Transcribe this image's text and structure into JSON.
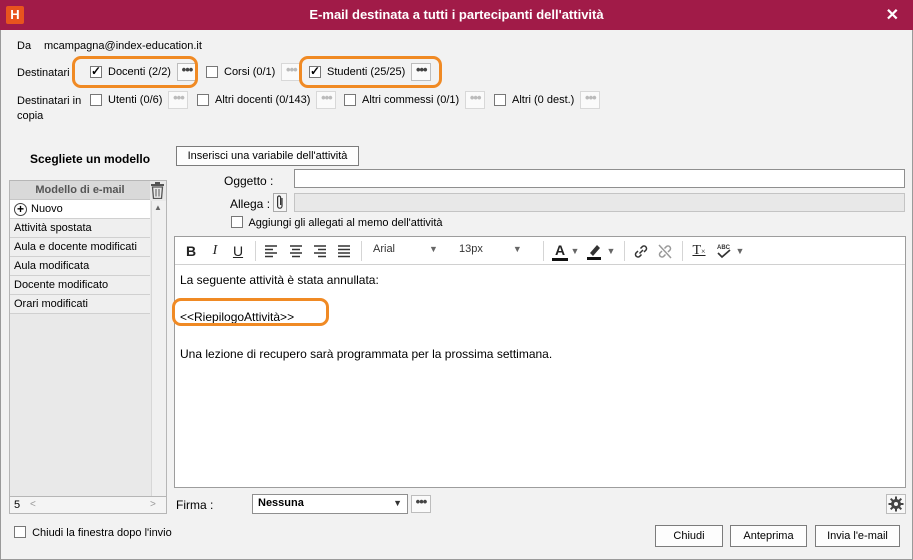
{
  "window": {
    "title": "E-mail destinata a tutti i partecipanti dell'attività",
    "app_icon": "H"
  },
  "from": {
    "label": "Da",
    "value": "mcampagna@index-education.it"
  },
  "recipients": {
    "label": "Destinatari",
    "items": [
      {
        "label": "Docenti (2/2)",
        "checked": true,
        "more": "•••"
      },
      {
        "label": "Corsi (0/1)",
        "checked": false,
        "more": "•••"
      },
      {
        "label": "Studenti (25/25)",
        "checked": true,
        "more": "•••"
      }
    ]
  },
  "cc": {
    "label_line1": "Destinatari in",
    "label_line2": "copia",
    "items": [
      {
        "label": "Utenti (0/6)",
        "checked": false,
        "more": "•••"
      },
      {
        "label": "Altri docenti (0/143)",
        "checked": false,
        "more": "•••"
      },
      {
        "label": "Altri commessi (0/1)",
        "checked": false,
        "more": "•••"
      },
      {
        "label": "Altri (0 dest.)",
        "checked": false,
        "more": "•••"
      }
    ]
  },
  "templates": {
    "title": "Scegliete un modello",
    "column_header": "Modello di e-mail",
    "new_label": "Nuovo",
    "items": [
      "Attività spostata",
      "Aula e docente modificati",
      "Aula modificata",
      "Docente modificato",
      "Orari modificati"
    ],
    "count": "5"
  },
  "insert_variable_button": "Inserisci una variabile dell'attività",
  "subject": {
    "label": "Oggetto :",
    "value": ""
  },
  "attach": {
    "label": "Allega :",
    "value": ""
  },
  "attach_to_memo": {
    "label": "Aggiungi gli allegati al memo dell'attività",
    "checked": false
  },
  "toolbar": {
    "bold": "B",
    "italic": "I",
    "underline": "U",
    "font_family": "Arial",
    "font_size": "13px",
    "font_color_letter": "A",
    "clear_format": "T"
  },
  "body": {
    "line1": "La seguente attività è stata annullata:",
    "variable": "<<RiepilogoAttività>>",
    "line3": "Una lezione di recupero sarà programmata per la prossima settimana."
  },
  "signature": {
    "label": "Firma :",
    "value": "Nessuna",
    "more": "•••"
  },
  "close_after_send": {
    "label": "Chiudi la finestra dopo l'invio",
    "checked": false
  },
  "buttons": {
    "close": "Chiudi",
    "preview": "Anteprima",
    "send": "Invia l'e-mail"
  },
  "colors": {
    "titlebar": "#a11b48",
    "highlight": "#f08a24"
  }
}
